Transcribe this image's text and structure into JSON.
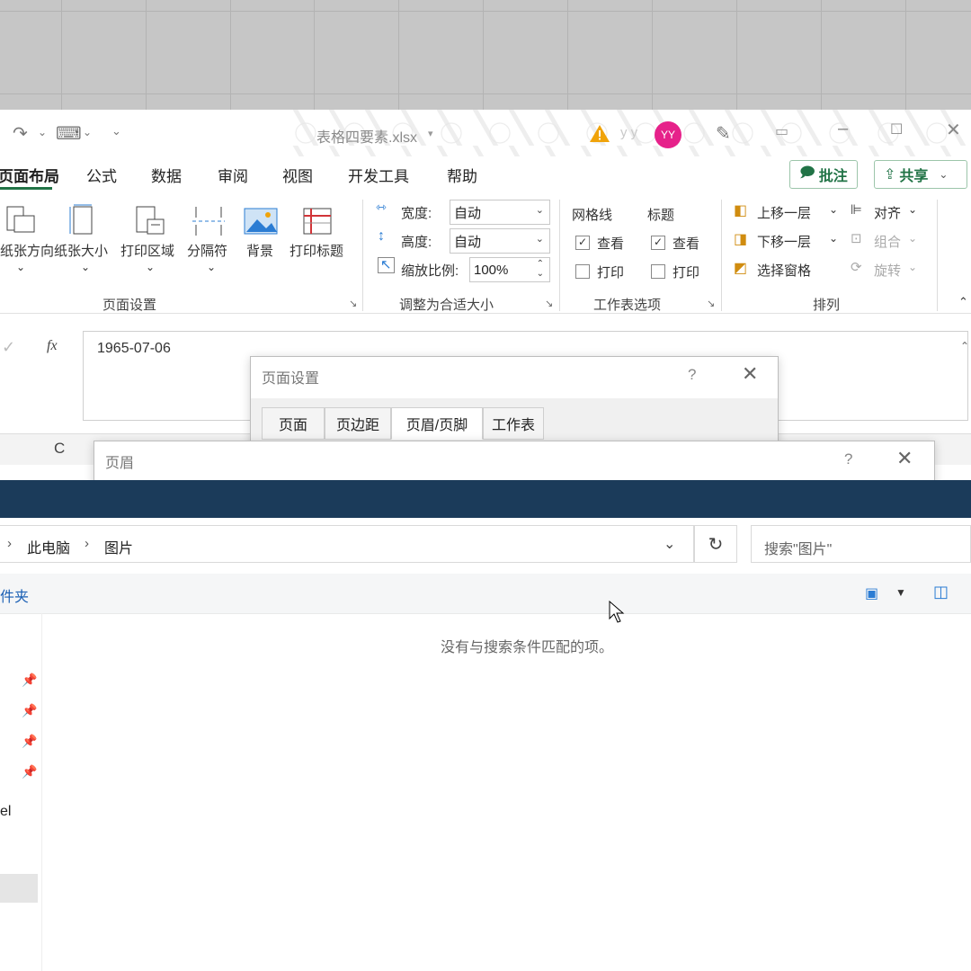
{
  "excel": {
    "doc_title": "表格四要素.xlsx",
    "user_initials_hidden": "y y",
    "avatar": "YY",
    "menu": [
      "页面布局",
      "公式",
      "数据",
      "审阅",
      "视图",
      "开发工具",
      "帮助"
    ],
    "comment_btn": "批注",
    "share_btn": "共享",
    "ribbon": {
      "page_setup": {
        "orientation": "纸张方向",
        "size": "纸张大小",
        "print_area": "打印区域",
        "breaks": "分隔符",
        "background": "背景",
        "print_titles": "打印标题",
        "group_label": "页面设置"
      },
      "scale": {
        "width_label": "宽度:",
        "width_value": "自动",
        "height_label": "高度:",
        "height_value": "自动",
        "scale_label": "缩放比例:",
        "scale_value": "100%",
        "group_label": "调整为合适大小"
      },
      "sheet_options": {
        "gridlines": "网格线",
        "headings": "标题",
        "view": "查看",
        "print": "打印",
        "group_label": "工作表选项"
      },
      "arrange": {
        "bring_forward": "上移一层",
        "send_backward": "下移一层",
        "selection_pane": "选择窗格",
        "align": "对齐",
        "group": "组合",
        "rotate": "旋转",
        "group_label": "排列"
      }
    },
    "formula_value": "1965-07-06",
    "fx": "fx",
    "column_c": "C"
  },
  "page_setup_dialog": {
    "title": "页面设置",
    "help": "?",
    "tabs": [
      "页面",
      "页边距",
      "页眉/页脚",
      "工作表"
    ],
    "active_tab": 2
  },
  "header_dialog": {
    "title": "页眉",
    "help": "?"
  },
  "explorer": {
    "breadcrumb": [
      "此电脑",
      "图片"
    ],
    "search_placeholder": "搜索\"图片\"",
    "cmd_partial": "件夹",
    "empty_message": "没有与搜索条件匹配的项。",
    "nav_partial": "el"
  },
  "colors": {
    "excel_green": "#217346",
    "avatar_pink": "#e6218a",
    "band_blue": "#1b3b5a"
  }
}
